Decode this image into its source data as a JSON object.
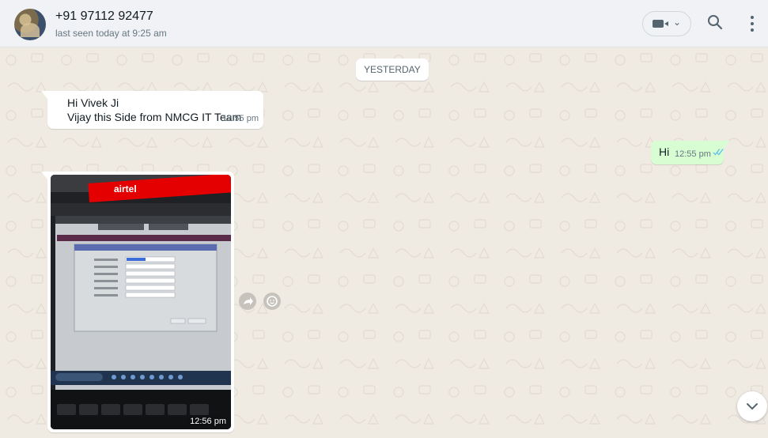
{
  "header": {
    "contact_name": "+91 97112 92477",
    "status": "last seen today at 9:25 am",
    "icons": [
      "avatar",
      "video-call-icon",
      "chevron-down-icon",
      "search-icon",
      "menu-icon"
    ]
  },
  "chat": {
    "date_divider": "YESTERDAY",
    "messages": [
      {
        "direction": "incoming",
        "lines": [
          "Hi Vivek Ji",
          "Vijay this Side from NMCG IT Team"
        ],
        "time": "12:55 pm"
      },
      {
        "direction": "outgoing",
        "text": "Hi",
        "time": "12:55 pm",
        "status": "read"
      },
      {
        "direction": "incoming",
        "type": "image",
        "time": "12:56 pm",
        "image_text": {
          "brand": "airtel"
        }
      }
    ]
  },
  "colors": {
    "incoming_bubble": "#ffffff",
    "outgoing_bubble": "#d9fdd3",
    "chat_background": "#efeae2",
    "read_ticks": "#53bdeb",
    "airtel_red": "#e40000"
  }
}
